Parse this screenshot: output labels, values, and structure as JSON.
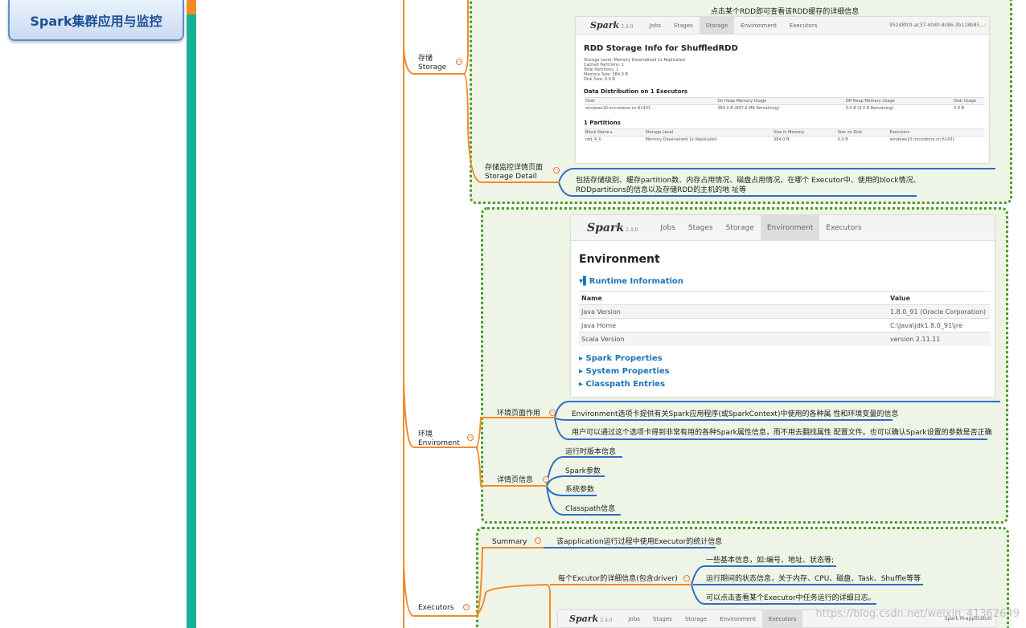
{
  "root_title": "Spark集群应用与监控",
  "branches": {
    "storage_label": "存储\nStorage",
    "storage_detail_label": "存储监控详情页面\nStorage Detail",
    "storage_rdd_note": "点击某个RDD即可查看该RDD缓存的详细信息",
    "storage_detail_desc": "包括存储级别、缓存partition数、内存占用情况、磁盘占用情况、在哪个 Executor中、使用的block情况、\nRDDpartitions的信息以及存储RDD的主机的地 址等",
    "env_label": "环境\nEnviroment",
    "env_purpose_label": "环境页面作用",
    "env_purpose_1": "Environment选项卡提供有关Spark应用程序(或SparkContext)中使用的各种属 性和环境变量的信息",
    "env_purpose_2": "用户可以通过这个选项卡得到非常有用的各种Spark属性信息，而不用去翻找属性 配置文件。也可以确认Spark设置的参数是否正确",
    "env_detail_label": "详情页信息",
    "env_details": [
      "运行时版本信息",
      "Spark参数",
      "系统参数",
      "Classpath信息"
    ],
    "executors_label": "Executors",
    "summary_label": "Summary",
    "summary_desc": "该application运行过程中使用Executor的统计信息",
    "executor_detail_label": "每个Excutor的详细信息(包含driver)",
    "executor_details": [
      "一些基本信息，如:编号、地址、状态等;",
      "运行期间的状态信息，关于内存、CPU、磁盘、Task、Shuffle等等",
      "可以点击查看某个Executor中任务运行的详细日志。"
    ]
  },
  "spark_ui_storage": {
    "logo": "Spark",
    "version": "2.4.0",
    "tabs": [
      "Jobs",
      "Stages",
      "Storage",
      "Environment",
      "Executors"
    ],
    "app_id": "952d8fc0-ac37-40d0-8c86-3b118b85...:",
    "title": "RDD Storage Info for ShuffledRDD",
    "meta": [
      "Storage Level: Memory Deserialized 1x Replicated",
      "Cached Partitions: 1",
      "Total Partitions: 1",
      "Memory Size: 384.0 B",
      "Disk Size: 0.0 B"
    ],
    "dist_title": "Data Distribution on 1 Executors",
    "dist_headers": [
      "Host",
      "On Heap Memory Usage",
      "Off Heap Memory Usage",
      "Disk Usage"
    ],
    "dist_row": [
      "windows10.microdone.cn:61431",
      "384.0 B (897.6 MB Remaining)",
      "0.0 B (0.0 B Remaining)",
      "0.0 B"
    ],
    "part_title": "1 Partitions",
    "part_headers": [
      "Block Name ▸",
      "Storage Level",
      "Size in Memory",
      "Size on Disk",
      "Executors"
    ],
    "part_row": [
      "rdd_4_0",
      "Memory Deserialized 1x Replicated",
      "384.0 B",
      "0.0 B",
      "windows10.microdone.cn:61431"
    ]
  },
  "spark_ui_env": {
    "logo": "Spark",
    "version": "2.4.0",
    "tabs": [
      "Jobs",
      "Stages",
      "Storage",
      "Environment",
      "Executors"
    ],
    "title": "Environment",
    "runtime_title": "Runtime Information",
    "headers": [
      "Name",
      "Value"
    ],
    "rows": [
      [
        "Java Version",
        "1.8.0_91 (Oracle Corporation)"
      ],
      [
        "Java Home",
        "C:\\Java\\jdk1.8.0_91\\jre"
      ],
      [
        "Scala Version",
        "version 2.11.11"
      ]
    ],
    "sections": [
      "Spark Properties",
      "System Properties",
      "Classpath Entries"
    ]
  },
  "spark_ui_exec": {
    "logo": "Spark",
    "version": "2.4.0",
    "tabs": [
      "Jobs",
      "Stages",
      "Storage",
      "Environment",
      "Executors"
    ],
    "app_name": "Spark Pi application"
  },
  "watermark": "https://blog.csdn.net/weixin_41362649",
  "colors": {
    "trunk": "#15b298",
    "branch": "#f38b2b",
    "leaf": "#2d6ec8",
    "zone_border": "#4a9a2a",
    "zone_fill": "#eef5e6"
  }
}
